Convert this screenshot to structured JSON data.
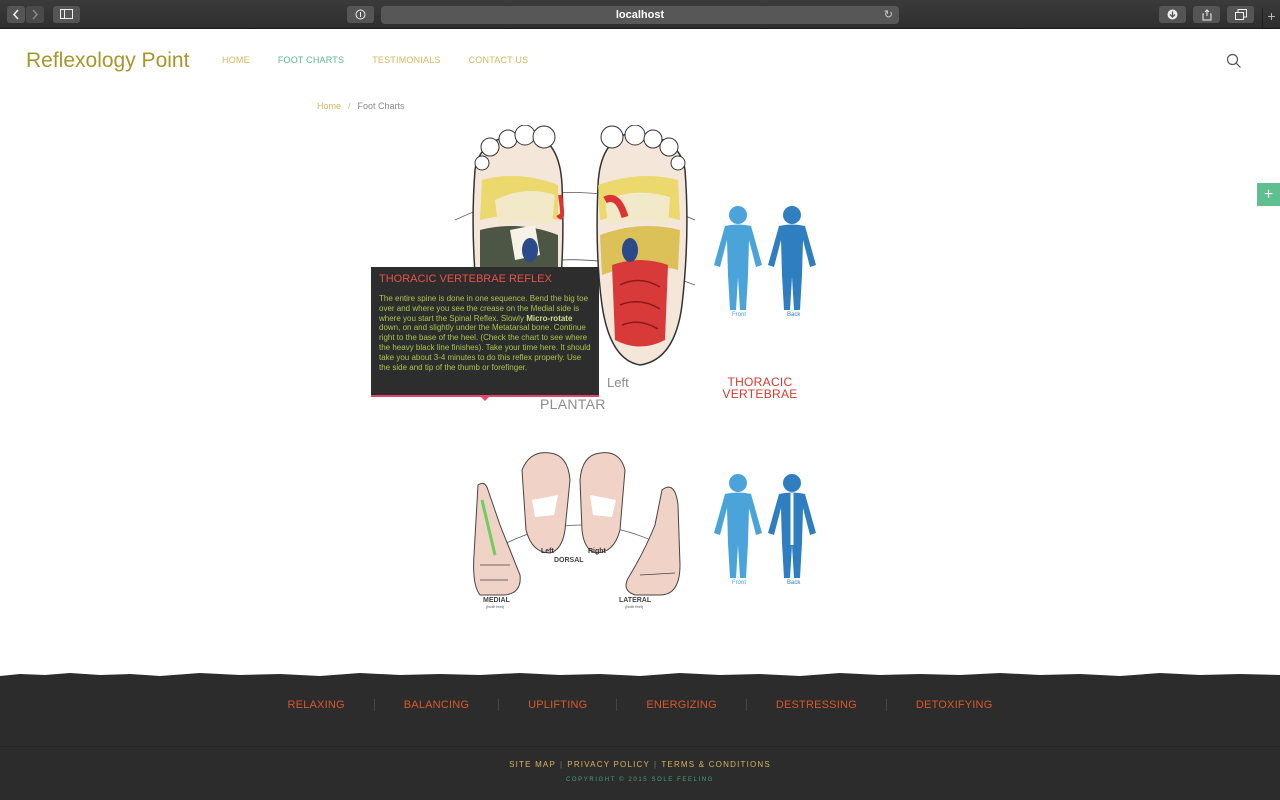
{
  "browser": {
    "url": "localhost"
  },
  "site": {
    "logo": "Reflexology Point",
    "nav": [
      {
        "label": "HOME"
      },
      {
        "label": "FOOT CHARTS"
      },
      {
        "label": "TESTIMONIALS"
      },
      {
        "label": "CONTACT US"
      }
    ]
  },
  "breadcrumb": {
    "home": "Home",
    "sep": "/",
    "current": "Foot Charts"
  },
  "chart1": {
    "left_label": "Left",
    "plantar_label": "PLANTAR",
    "vertebrae_label_line1": "THORACIC",
    "vertebrae_label_line2": "VERTEBRAE",
    "front": "Front",
    "back": "Back"
  },
  "chart2": {
    "left": "Left",
    "right": "Right",
    "dorsal": "DORSAL",
    "medial": "MEDIAL",
    "medial_sub": "(both feet)",
    "lateral": "LATERAL",
    "lateral_sub": "(both feet)",
    "front": "Front",
    "back": "Back"
  },
  "tooltip": {
    "title": "THORACIC VERTEBRAE REFLEX",
    "body_1": "The entire spine is done in one sequence. Bend the big toe over and where you see the crease on the Medial side is where you start the Spinal Reflex. Slowly ",
    "body_bold": "Micro-rotate",
    "body_2": " down, on and slightly under the Metatarsal bone. Continue right to the base of the heel. (Check the chart to see where the heavy black line finishes). Take your time here. It should take you about 3-4 minutes to do this reflex properly. Use the side and tip of the thumb or forefinger."
  },
  "footer": {
    "categories": [
      "RELAXING",
      "BALANCING",
      "UPLIFTING",
      "ENERGIZING",
      "DESTRESSING",
      "DETOXIFYING"
    ],
    "links": [
      "SITE MAP",
      "PRIVACY POLICY",
      "TERMS & CONDITIONS"
    ],
    "copyright": "COPYRIGHT © 2015 SOLE FEELING"
  },
  "colors": {
    "brand": "#a8962a",
    "nav": "#d7b85c",
    "nav_active": "#5cb98a",
    "accent_red": "#d6382e",
    "footer_bg": "#2c2c2c",
    "footer_cat": "#d8592b"
  },
  "icons": [
    "back-icon",
    "forward-icon",
    "sidebar-icon",
    "reader-icon",
    "reload-icon",
    "download-icon",
    "share-icon",
    "tabs-icon",
    "plus-icon",
    "search-icon"
  ]
}
